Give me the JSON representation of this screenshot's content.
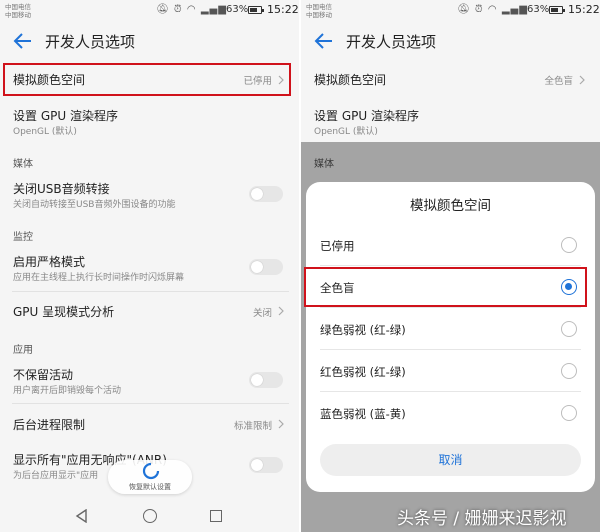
{
  "status": {
    "carrier_line1": "中国电信",
    "carrier_line2": "中国移动",
    "battery": "63%",
    "time": "15:22"
  },
  "header": {
    "title": "开发人员选项",
    "back_icon": "back-arrow-icon"
  },
  "left_list": {
    "simulate_color_space": {
      "title": "模拟颜色空间",
      "value": "已停用"
    },
    "gpu_renderer": {
      "title": "设置 GPU 渲染程序",
      "subtitle": "OpenGL (默认)"
    },
    "section_media": "媒体",
    "disable_usb_audio": {
      "title": "关闭USB音频转接",
      "subtitle": "关闭自动转接至USB音频外围设备的功能"
    },
    "section_monitoring": "监控",
    "strict_mode": {
      "title": "启用严格模式",
      "subtitle": "应用在主线程上执行长时间操作时闪烁屏幕"
    },
    "gpu_profile": {
      "title": "GPU 呈现模式分析",
      "value": "关闭"
    },
    "section_apps": "应用",
    "dont_keep_activities": {
      "title": "不保留活动",
      "subtitle": "用户离开后即销毁每个活动"
    },
    "bg_process_limit": {
      "title": "后台进程限制",
      "value": "标准限制"
    },
    "show_anr": {
      "title": "显示所有\"应用无响应\"(ANR)",
      "subtitle": "为后台应用显示\"应用"
    }
  },
  "restore_defaults": {
    "label": "恢复默认设置"
  },
  "right_list": {
    "simulate_color_space": {
      "title": "模拟颜色空间",
      "value": "全色盲"
    },
    "gpu_renderer": {
      "title": "设置 GPU 渲染程序",
      "subtitle": "OpenGL (默认)"
    },
    "section_media": "媒体"
  },
  "dialog": {
    "title": "模拟颜色空间",
    "options": [
      {
        "label": "已停用",
        "selected": false
      },
      {
        "label": "全色盲",
        "selected": true
      },
      {
        "label": "绿色弱视 (红-绿)",
        "selected": false
      },
      {
        "label": "红色弱视 (红-绿)",
        "selected": false
      },
      {
        "label": "蓝色弱视 (蓝-黄)",
        "selected": false
      }
    ],
    "cancel": "取消"
  },
  "watermark": "头条号 / 姗姗来迟影视",
  "colors": {
    "accent": "#1f73d8",
    "highlight_box": "#d0121b"
  }
}
